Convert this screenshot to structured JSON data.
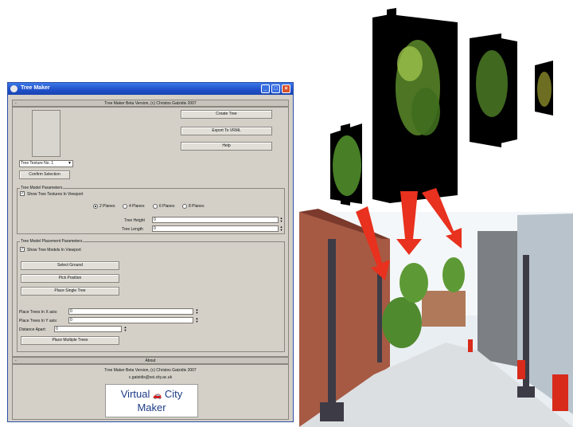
{
  "window": {
    "title": "Tree Maker",
    "controls": {
      "minimize": "_",
      "maximize": "□",
      "close": "×"
    }
  },
  "rollout_main": {
    "title": "Tree Maker Beta Version, (c) Christos Gatzidis 2007",
    "collapse_symbol": "-",
    "buttons": {
      "create_tree": "Create Tree",
      "export_vrml": "Export To VRML",
      "help": "Help",
      "confirm_selection": "Confirm Selection"
    },
    "texture_dropdown": {
      "value": "Tree Texture No. 1"
    },
    "model_parameters": {
      "title": "Tree Model Parameters",
      "show_textures_label": "Show Tree Textures In Viewport",
      "show_textures_checked": true,
      "planes": [
        "2 Planes",
        "4 Planes",
        "6 Planes",
        "8 Planes"
      ],
      "planes_selected": "2 Planes",
      "tree_height_label": "Tree Height",
      "tree_height_value": "0",
      "tree_length_label": "Tree Length",
      "tree_length_value": "0"
    },
    "placement_parameters": {
      "title": "Tree Model Placement Parameters",
      "show_models_label": "Show Tree Models In Viewport",
      "show_models_checked": true,
      "select_ground": "Select Ground",
      "pick_position": "Pick Position",
      "place_single_tree": "Place Single Tree",
      "place_x_label": "Place Trees In X axis:",
      "place_x_value": "0",
      "place_y_label": "Place Trees In Y axis:",
      "place_y_value": "0",
      "distance_label": "Distance Apart:",
      "distance_value": "0",
      "place_multiple_trees": "Place Multiple Trees"
    }
  },
  "rollout_about": {
    "title": "About",
    "collapse_symbol": "-",
    "line1": "Tree Maker Beta Version, (c) Christos Gatzidis 2007",
    "line2": "c.gatzidis@soi.city.ac.uk"
  },
  "logo": {
    "line1_a": "Virtual",
    "line1_b": "City",
    "line2": "Maker"
  },
  "colors": {
    "titlebar": "#1f4fc9",
    "panel": "#d4d0c8",
    "arrow": "#e8311e"
  },
  "icons": {
    "app": "app-icon",
    "logo_car": "car-icon"
  }
}
